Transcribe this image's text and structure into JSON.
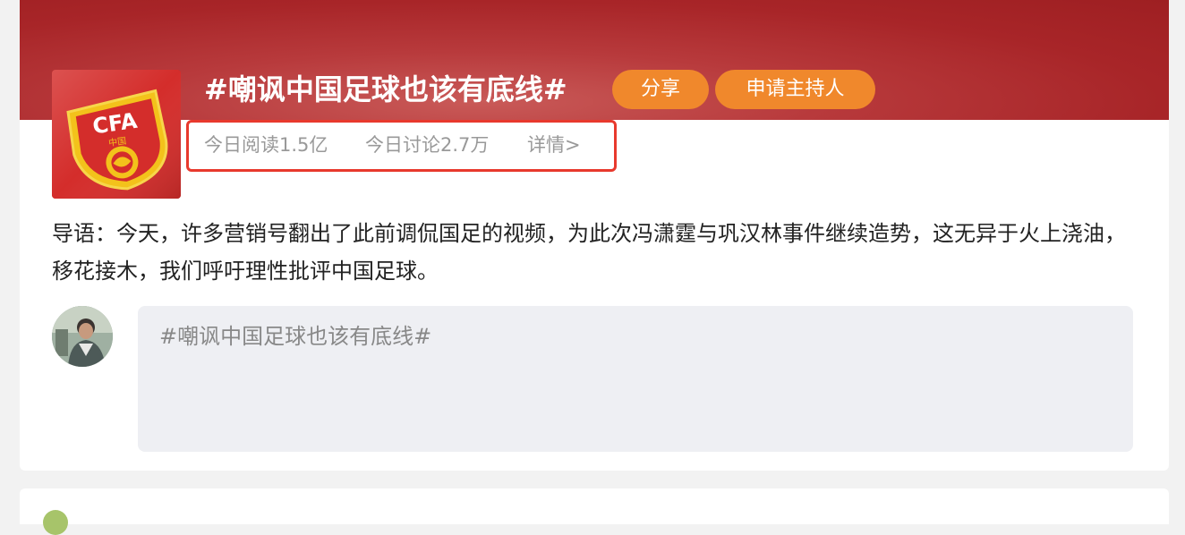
{
  "topic": {
    "title": "#嘲讽中国足球也该有底线#",
    "share_label": "分享",
    "apply_host_label": "申请主持人",
    "logo_text": "CFA",
    "logo_subtext": "中国"
  },
  "stats": {
    "today_read": "今日阅读1.5亿",
    "today_discuss": "今日讨论2.7万",
    "detail_link": "详情>"
  },
  "lead": {
    "text": "导语：今天，许多营销号翻出了此前调侃国足的视频，为此次冯潇霆与巩汉林事件继续造势，这无异于火上浇油，移花接木，我们呼吁理性批评中国足球。"
  },
  "compose": {
    "value": "#嘲讽中国足球也该有底线#"
  },
  "colors": {
    "banner": "#a82528",
    "pill": "#f0882c",
    "highlight_border": "#e8392d"
  }
}
